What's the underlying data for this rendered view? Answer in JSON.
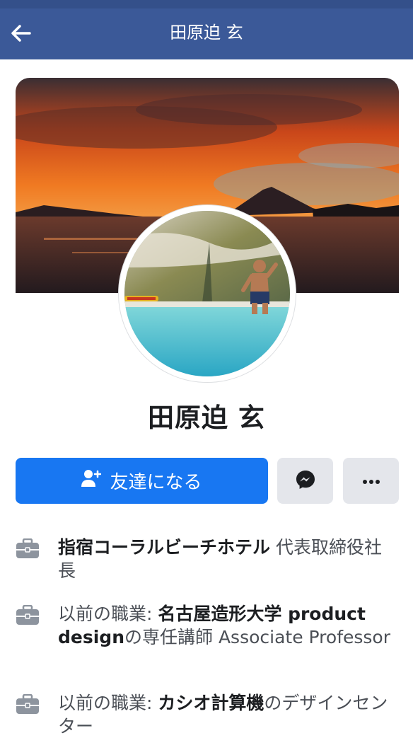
{
  "header": {
    "title": "田原迫 玄"
  },
  "profile": {
    "name": "田原迫 玄"
  },
  "actions": {
    "add_friend_label": "友達になる"
  },
  "info": [
    {
      "icon": "briefcase-icon",
      "prefix": "",
      "highlight": "指宿コーラルビーチホテル",
      "suffix": " 代表取締役社長"
    },
    {
      "icon": "briefcase-icon",
      "prefix": "以前の職業: ",
      "highlight": "名古屋造形大学 product design",
      "suffix": "の専任講師 Associate Professor"
    },
    {
      "icon": "briefcase-icon",
      "prefix": "以前の職業: ",
      "highlight": "カシオ計算機",
      "suffix": "のデザインセンター"
    }
  ],
  "colors": {
    "topbar": "#3b5998",
    "primary_button": "#1877f2",
    "secondary_button": "#e4e6eb"
  }
}
